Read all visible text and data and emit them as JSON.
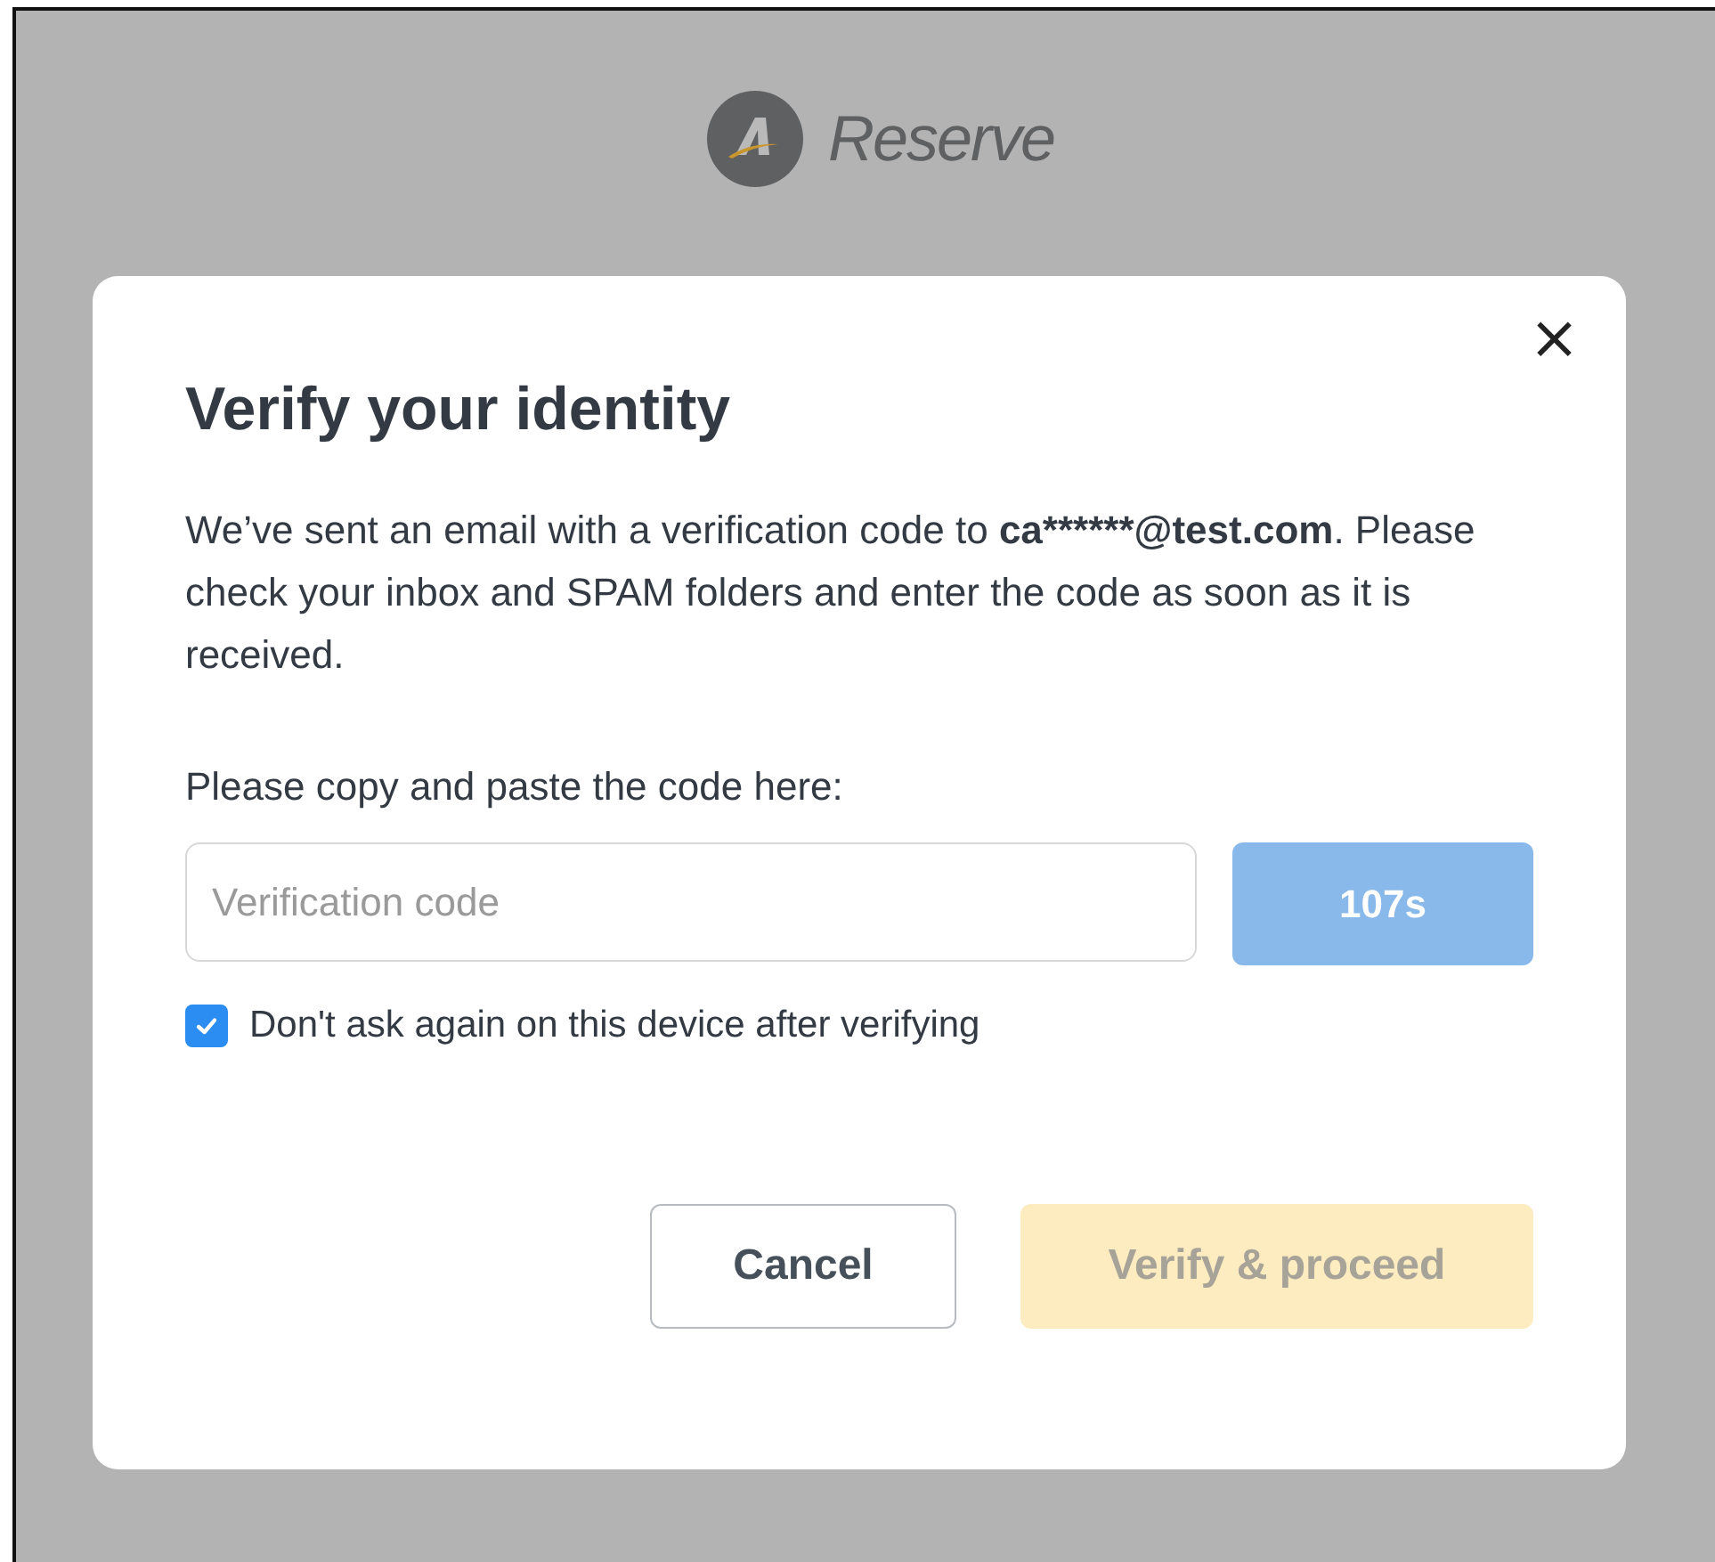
{
  "logo": {
    "text": "Reserve"
  },
  "dialog": {
    "title": "Verify your identity",
    "close_label": "×",
    "message": {
      "before": "We’ve sent an email with a verification code to ",
      "email": "ca******@test.com",
      "after": ". Please check your inbox and SPAM folders and enter the code as soon as it is received."
    },
    "code_label": "Please copy and paste the code here:",
    "code_field": {
      "placeholder": "Verification code"
    },
    "resend_button": {
      "label": "107s",
      "disabled": true
    },
    "remember": {
      "label": "Don't ask again on this device after verifying",
      "checked": true
    },
    "buttons": [
      {
        "kind": "secondary",
        "label": "Cancel",
        "disabled": false
      },
      {
        "kind": "primary",
        "label": "Verify & proceed",
        "disabled": true
      }
    ]
  }
}
